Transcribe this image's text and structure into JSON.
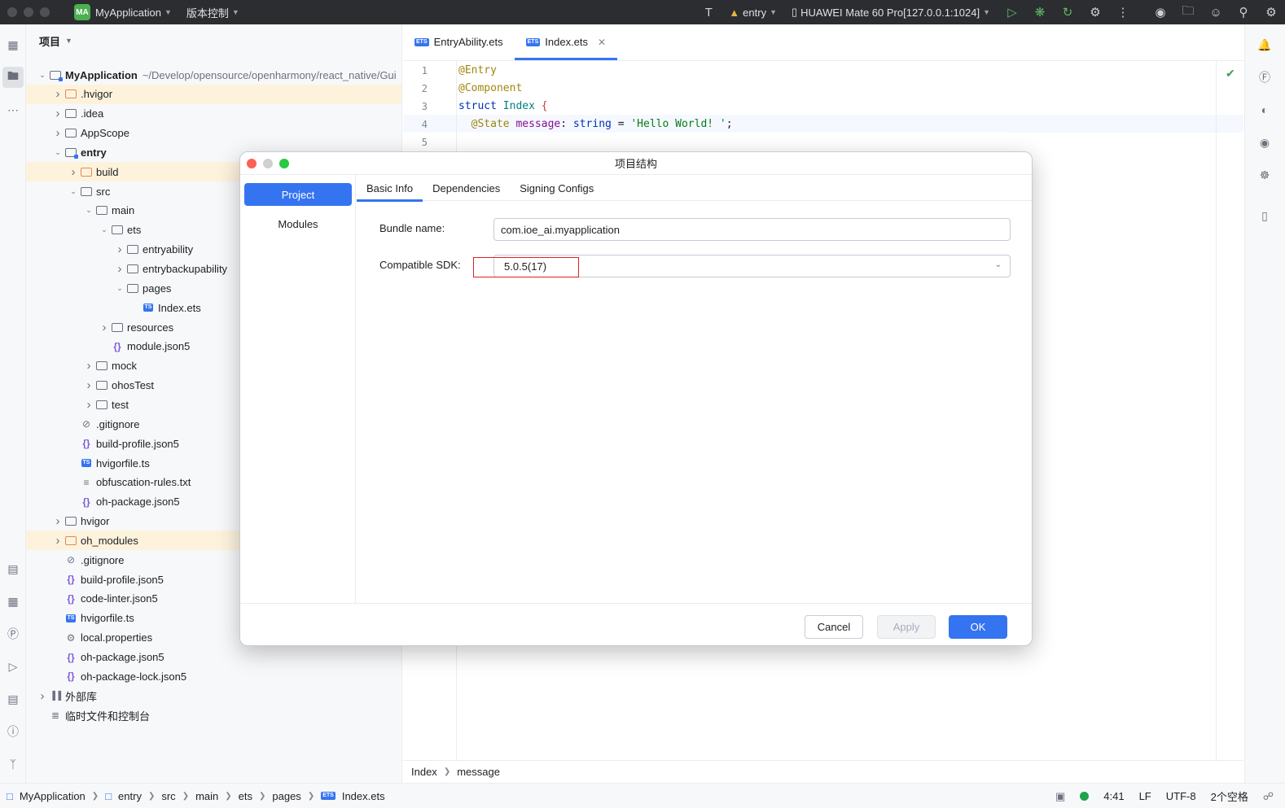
{
  "titlebar": {
    "project_badge": "MA",
    "project_name": "MyApplication",
    "vcs_label": "版本控制",
    "run_config": "entry",
    "device": "HUAWEI Mate 60 Pro[127.0.0.1:1024]"
  },
  "project_panel": {
    "title": "项目",
    "tree": [
      {
        "label": "MyApplication",
        "path": "~/Develop/opensource/openharmony/react_native/Gui",
        "indent": 0,
        "chev": "open",
        "icon": "module",
        "bold": true,
        "hl": false
      },
      {
        "label": ".hvigor",
        "indent": 1,
        "chev": "closed",
        "icon": "folder-orange",
        "hl": true
      },
      {
        "label": ".idea",
        "indent": 1,
        "chev": "closed",
        "icon": "folder",
        "hl": false
      },
      {
        "label": "AppScope",
        "indent": 1,
        "chev": "closed",
        "icon": "folder",
        "hl": false
      },
      {
        "label": "entry",
        "indent": 1,
        "chev": "open",
        "icon": "module",
        "bold": true,
        "hl": false
      },
      {
        "label": "build",
        "indent": 2,
        "chev": "closed",
        "icon": "folder-orange",
        "hl": true
      },
      {
        "label": "src",
        "indent": 2,
        "chev": "open",
        "icon": "folder",
        "hl": false
      },
      {
        "label": "main",
        "indent": 3,
        "chev": "open",
        "icon": "folder",
        "hl": false
      },
      {
        "label": "ets",
        "indent": 4,
        "chev": "open",
        "icon": "folder",
        "hl": false
      },
      {
        "label": "entryability",
        "indent": 5,
        "chev": "closed",
        "icon": "folder",
        "hl": false
      },
      {
        "label": "entrybackupability",
        "indent": 5,
        "chev": "closed",
        "icon": "folder",
        "hl": false
      },
      {
        "label": "pages",
        "indent": 5,
        "chev": "open",
        "icon": "folder",
        "hl": false
      },
      {
        "label": "Index.ets",
        "indent": 6,
        "chev": "none",
        "icon": "ts",
        "hl": false
      },
      {
        "label": "resources",
        "indent": 4,
        "chev": "closed",
        "icon": "folder",
        "hl": false
      },
      {
        "label": "module.json5",
        "indent": 4,
        "chev": "none",
        "icon": "json",
        "hl": false
      },
      {
        "label": "mock",
        "indent": 3,
        "chev": "closed",
        "icon": "folder",
        "hl": false
      },
      {
        "label": "ohosTest",
        "indent": 3,
        "chev": "closed",
        "icon": "folder",
        "hl": false
      },
      {
        "label": "test",
        "indent": 3,
        "chev": "closed",
        "icon": "folder",
        "hl": false
      },
      {
        "label": ".gitignore",
        "indent": 2,
        "chev": "none",
        "icon": "ignore",
        "hl": false
      },
      {
        "label": "build-profile.json5",
        "indent": 2,
        "chev": "none",
        "icon": "json",
        "hl": false
      },
      {
        "label": "hvigorfile.ts",
        "indent": 2,
        "chev": "none",
        "icon": "ts",
        "hl": false
      },
      {
        "label": "obfuscation-rules.txt",
        "indent": 2,
        "chev": "none",
        "icon": "text",
        "hl": false
      },
      {
        "label": "oh-package.json5",
        "indent": 2,
        "chev": "none",
        "icon": "json",
        "hl": false
      },
      {
        "label": "hvigor",
        "indent": 1,
        "chev": "closed",
        "icon": "folder",
        "hl": false
      },
      {
        "label": "oh_modules",
        "indent": 1,
        "chev": "closed",
        "icon": "folder-orange",
        "hl": true
      },
      {
        "label": ".gitignore",
        "indent": 1,
        "chev": "none",
        "icon": "ignore",
        "hl": false
      },
      {
        "label": "build-profile.json5",
        "indent": 1,
        "chev": "none",
        "icon": "json",
        "hl": false
      },
      {
        "label": "code-linter.json5",
        "indent": 1,
        "chev": "none",
        "icon": "json",
        "hl": false
      },
      {
        "label": "hvigorfile.ts",
        "indent": 1,
        "chev": "none",
        "icon": "ts",
        "hl": false
      },
      {
        "label": "local.properties",
        "indent": 1,
        "chev": "none",
        "icon": "gear",
        "hl": false
      },
      {
        "label": "oh-package.json5",
        "indent": 1,
        "chev": "none",
        "icon": "json",
        "hl": false
      },
      {
        "label": "oh-package-lock.json5",
        "indent": 1,
        "chev": "none",
        "icon": "json",
        "hl": false
      },
      {
        "label": "外部库",
        "indent": 0,
        "chev": "closed",
        "icon": "library",
        "hl": false
      },
      {
        "label": "临时文件和控制台",
        "indent": 0,
        "chev": "none",
        "icon": "scratch",
        "hl": false
      }
    ]
  },
  "editor": {
    "tabs": [
      {
        "label": "EntryAbility.ets",
        "active": false
      },
      {
        "label": "Index.ets",
        "active": true
      }
    ],
    "line_numbers": [
      "1",
      "2",
      "3",
      "4",
      "5"
    ],
    "code": {
      "l1": "@Entry",
      "l2": "@Component",
      "l3_kw": "struct",
      "l3_name": "Index",
      "l3_brace": "{",
      "l4_ann": "@State",
      "l4_field": "message",
      "l4_colon": ":",
      "l4_type": "string",
      "l4_eq": "=",
      "l4_str": "'Hello World! '",
      "l4_semi": ";"
    },
    "breadcrumb": [
      "Index",
      "message"
    ]
  },
  "dialog": {
    "title": "项目结构",
    "side_items": [
      {
        "label": "Project",
        "selected": true
      },
      {
        "label": "Modules",
        "selected": false
      }
    ],
    "tabs": [
      {
        "label": "Basic Info",
        "active": true
      },
      {
        "label": "Dependencies",
        "active": false
      },
      {
        "label": "Signing Configs",
        "active": false
      }
    ],
    "bundle_label": "Bundle name:",
    "bundle_value": "com.ioe_ai.myapplication",
    "sdk_label": "Compatible SDK:",
    "sdk_value": "5.0.5(17)",
    "cancel": "Cancel",
    "apply": "Apply",
    "ok": "OK"
  },
  "statusbar": {
    "path": [
      "MyApplication",
      "entry",
      "src",
      "main",
      "ets",
      "pages",
      "Index.ets"
    ],
    "position": "4:41",
    "line_sep": "LF",
    "encoding": "UTF-8",
    "indent": "2个空格"
  },
  "colors": {
    "accent": "#3574f0",
    "close_red": "#ff5f57",
    "minimize": "#d0d0d0",
    "zoom_green": "#28c840",
    "highlight_row": "#fdf3dd",
    "annotation_red": "#e02020"
  }
}
